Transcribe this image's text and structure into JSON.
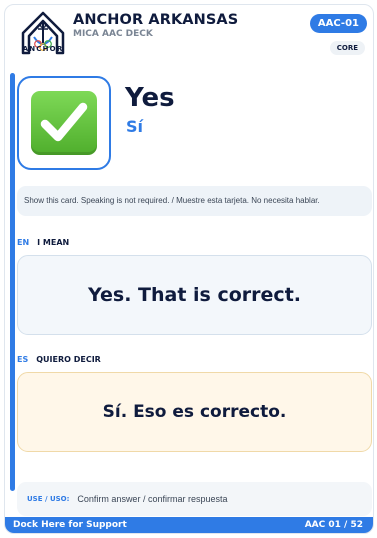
{
  "header": {
    "logo_text": "ANCHOR",
    "brand_title": "ANCHOR ARKANSAS",
    "deck_name": "MICA AAC DECK",
    "card_id": "AAC-01",
    "category_badge": "CORE"
  },
  "symbol": {
    "icon": "check-mark-icon",
    "color": "#5cbf3a"
  },
  "word": {
    "en": "Yes",
    "es": "Sí"
  },
  "instruction": "Show this card. Speaking is not required. / Muestre esta tarjeta. No necesita hablar.",
  "english": {
    "code": "EN",
    "label": "I MEAN",
    "phrase": "Yes. That is correct."
  },
  "spanish": {
    "code": "ES",
    "label": "QUIERO DECIR",
    "phrase": "Sí. Eso es correcto."
  },
  "usage": {
    "label": "USE / USO:",
    "text": "Confirm answer / confirmar respuesta"
  },
  "footer": {
    "left": "Dock Here for Support",
    "right": "AAC 01 / 52"
  },
  "colors": {
    "accent": "#2f7be5",
    "navy": "#0f1b3d",
    "english_panel": "#f3f7fb",
    "spanish_panel": "#fff7e9"
  }
}
